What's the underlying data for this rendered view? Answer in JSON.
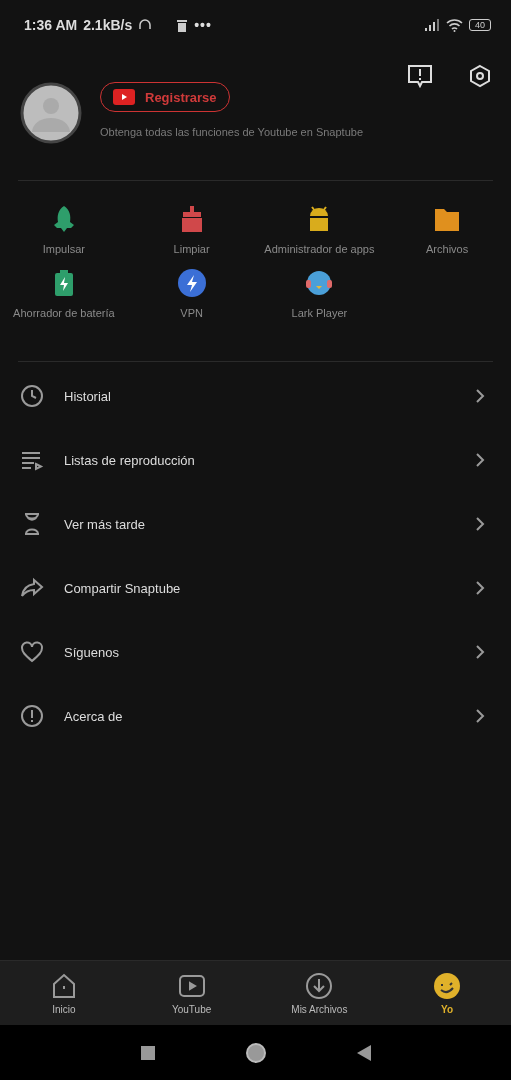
{
  "status_bar": {
    "time": "1:36 AM",
    "speed": "2.1kB/s",
    "more": "•••",
    "battery": "40"
  },
  "profile": {
    "button": "Registrarse",
    "subtitle": "Obtenga todas las funciones de Youtube en Snaptube"
  },
  "tools": [
    {
      "kind": "rocket",
      "label": "Impulsar",
      "color": "#2e9e6b"
    },
    {
      "kind": "clean",
      "label": "Limpiar",
      "color": "#d0484a"
    },
    {
      "kind": "android",
      "label": "Administrador de apps",
      "color": "#d9ac1c"
    },
    {
      "kind": "folder",
      "label": "Archivos",
      "color": "#e0901e"
    },
    {
      "kind": "battery",
      "label": "Ahorrador de batería",
      "color": "#2e9e6b"
    },
    {
      "kind": "vpn",
      "label": "VPN",
      "color": "#3b6fd6"
    },
    {
      "kind": "bird",
      "label": "Lark Player",
      "color": "#4a9fd8"
    }
  ],
  "menu": [
    {
      "kind": "history",
      "label": "Historial"
    },
    {
      "kind": "playlist",
      "label": "Listas de reproducción"
    },
    {
      "kind": "hourglass",
      "label": "Ver más tarde"
    },
    {
      "kind": "share",
      "label": "Compartir Snaptube"
    },
    {
      "kind": "heart",
      "label": "Síguenos"
    },
    {
      "kind": "info",
      "label": "Acerca de"
    }
  ],
  "nav": [
    {
      "kind": "home",
      "label": "Inicio",
      "selected": false
    },
    {
      "kind": "youtube",
      "label": "YouTube",
      "selected": false
    },
    {
      "kind": "download",
      "label": "Mis Archivos",
      "selected": false
    },
    {
      "kind": "me",
      "label": "Yo",
      "selected": true
    }
  ]
}
